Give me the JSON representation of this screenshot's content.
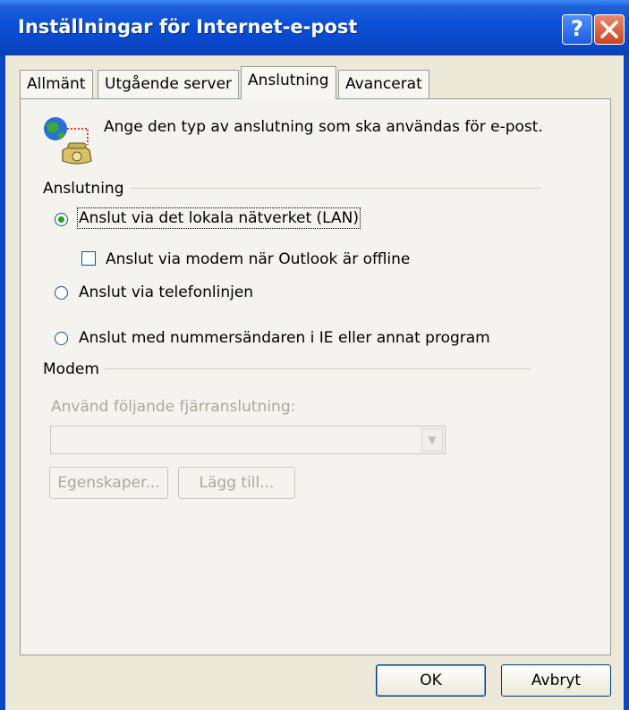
{
  "window": {
    "title": "Inställningar för Internet-e-post",
    "help_label": "?",
    "close_label": "×"
  },
  "tabs": [
    {
      "label": "Allmänt"
    },
    {
      "label": "Utgående server"
    },
    {
      "label": "Anslutning"
    },
    {
      "label": "Avancerat"
    }
  ],
  "intro_text": "Ange den typ av anslutning som ska användas för e-post.",
  "connection_group": {
    "label": "Anslutning",
    "options": [
      {
        "label": "Anslut via det lokala nätverket (LAN)",
        "type": "radio",
        "checked": true
      },
      {
        "label": "Anslut via modem när Outlook är offline",
        "type": "checkbox",
        "checked": false
      },
      {
        "label": "Anslut via telefonlinjen",
        "type": "radio",
        "checked": false
      },
      {
        "label": "Anslut med nummersändaren i IE eller annat program",
        "type": "radio",
        "checked": false
      }
    ]
  },
  "modem_group": {
    "label": "Modem",
    "dialup_label": "Använd följande fjärranslutning:",
    "dialup_value": "",
    "properties_label": "Egenskaper...",
    "add_label": "Lägg till..."
  },
  "footer": {
    "ok_label": "OK",
    "cancel_label": "Avbryt"
  },
  "colors": {
    "titlebar": "#0a46c8",
    "body": "#ece9d8",
    "panel": "#f4f3ee",
    "disabled_text": "#aca899"
  }
}
